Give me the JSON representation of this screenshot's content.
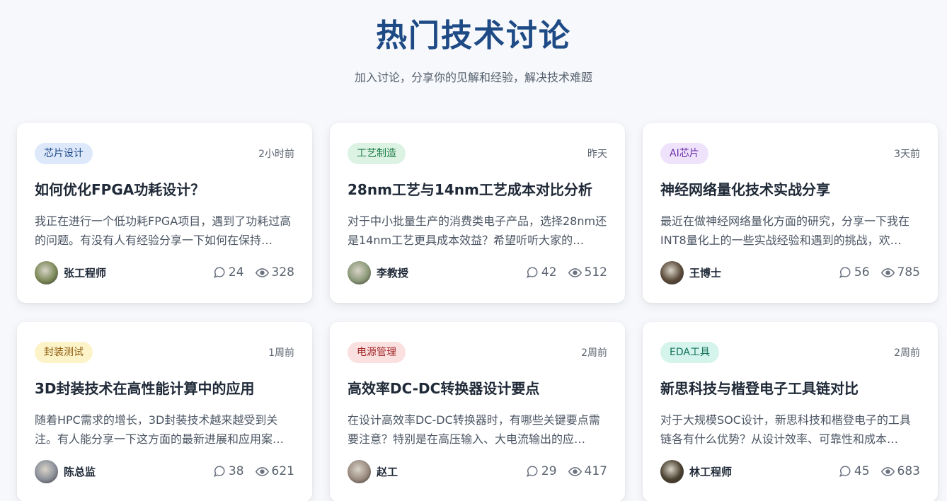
{
  "header": {
    "title": "热门技术讨论",
    "subtitle": "加入讨论，分享你的见解和经验，解决技术难题"
  },
  "colors": {
    "title": "#1e4a85",
    "background": "#f6f8fb"
  },
  "cards": [
    {
      "tag": "芯片设计",
      "tag_bg": "#dde8fb",
      "tag_color": "#1e4a85",
      "time": "2小时前",
      "title": "如何优化FPGA功耗设计？",
      "desc": "我正在进行一个低功耗FPGA项目，遇到了功耗过高的问题。有没有人有经验分享一下如何在保持…",
      "author": "张工程师",
      "avatar": "#7d8a5a",
      "comments": "24",
      "views": "328"
    },
    {
      "tag": "工艺制造",
      "tag_bg": "#dcf3e4",
      "tag_color": "#1e7a45",
      "time": "昨天",
      "title": "28nm工艺与14nm工艺成本对比分析",
      "desc": "对于中小批量生产的消费类电子产品，选择28nm还是14nm工艺更具成本效益？希望听听大家的…",
      "author": "李教授",
      "avatar": "#8c9a7a",
      "comments": "42",
      "views": "512"
    },
    {
      "tag": "AI芯片",
      "tag_bg": "#efe3fb",
      "tag_color": "#6b2fa8",
      "time": "3天前",
      "title": "神经网络量化技术实战分享",
      "desc": "最近在做神经网络量化方面的研究，分享一下我在INT8量化上的一些实战经验和遇到的挑战，欢…",
      "author": "王博士",
      "avatar": "#5a4a3a",
      "comments": "56",
      "views": "785"
    },
    {
      "tag": "封装测试",
      "tag_bg": "#fdf3c8",
      "tag_color": "#8a5a0b",
      "time": "1周前",
      "title": "3D封装技术在高性能计算中的应用",
      "desc": "随着HPC需求的增长，3D封装技术越来越受到关注。有人能分享一下这方面的最新进展和应用案…",
      "author": "陈总监",
      "avatar": "#8a8f9a",
      "comments": "38",
      "views": "621"
    },
    {
      "tag": "电源管理",
      "tag_bg": "#fbe0e0",
      "tag_color": "#a02828",
      "time": "2周前",
      "title": "高效率DC-DC转换器设计要点",
      "desc": "在设计高效率DC-DC转换器时，有哪些关键要点需要注意？特别是在高压输入、大电流输出的应…",
      "author": "赵工",
      "avatar": "#9a8a80",
      "comments": "29",
      "views": "417"
    },
    {
      "tag": "EDA工具",
      "tag_bg": "#d5f5ec",
      "tag_color": "#12715a",
      "time": "2周前",
      "title": "新思科技与楷登电子工具链对比",
      "desc": "对于大规模SOC设计，新思科技和楷登电子的工具链各有什么优势？从设计效率、可靠性和成本…",
      "author": "林工程师",
      "avatar": "#4a4030",
      "comments": "45",
      "views": "683"
    }
  ]
}
